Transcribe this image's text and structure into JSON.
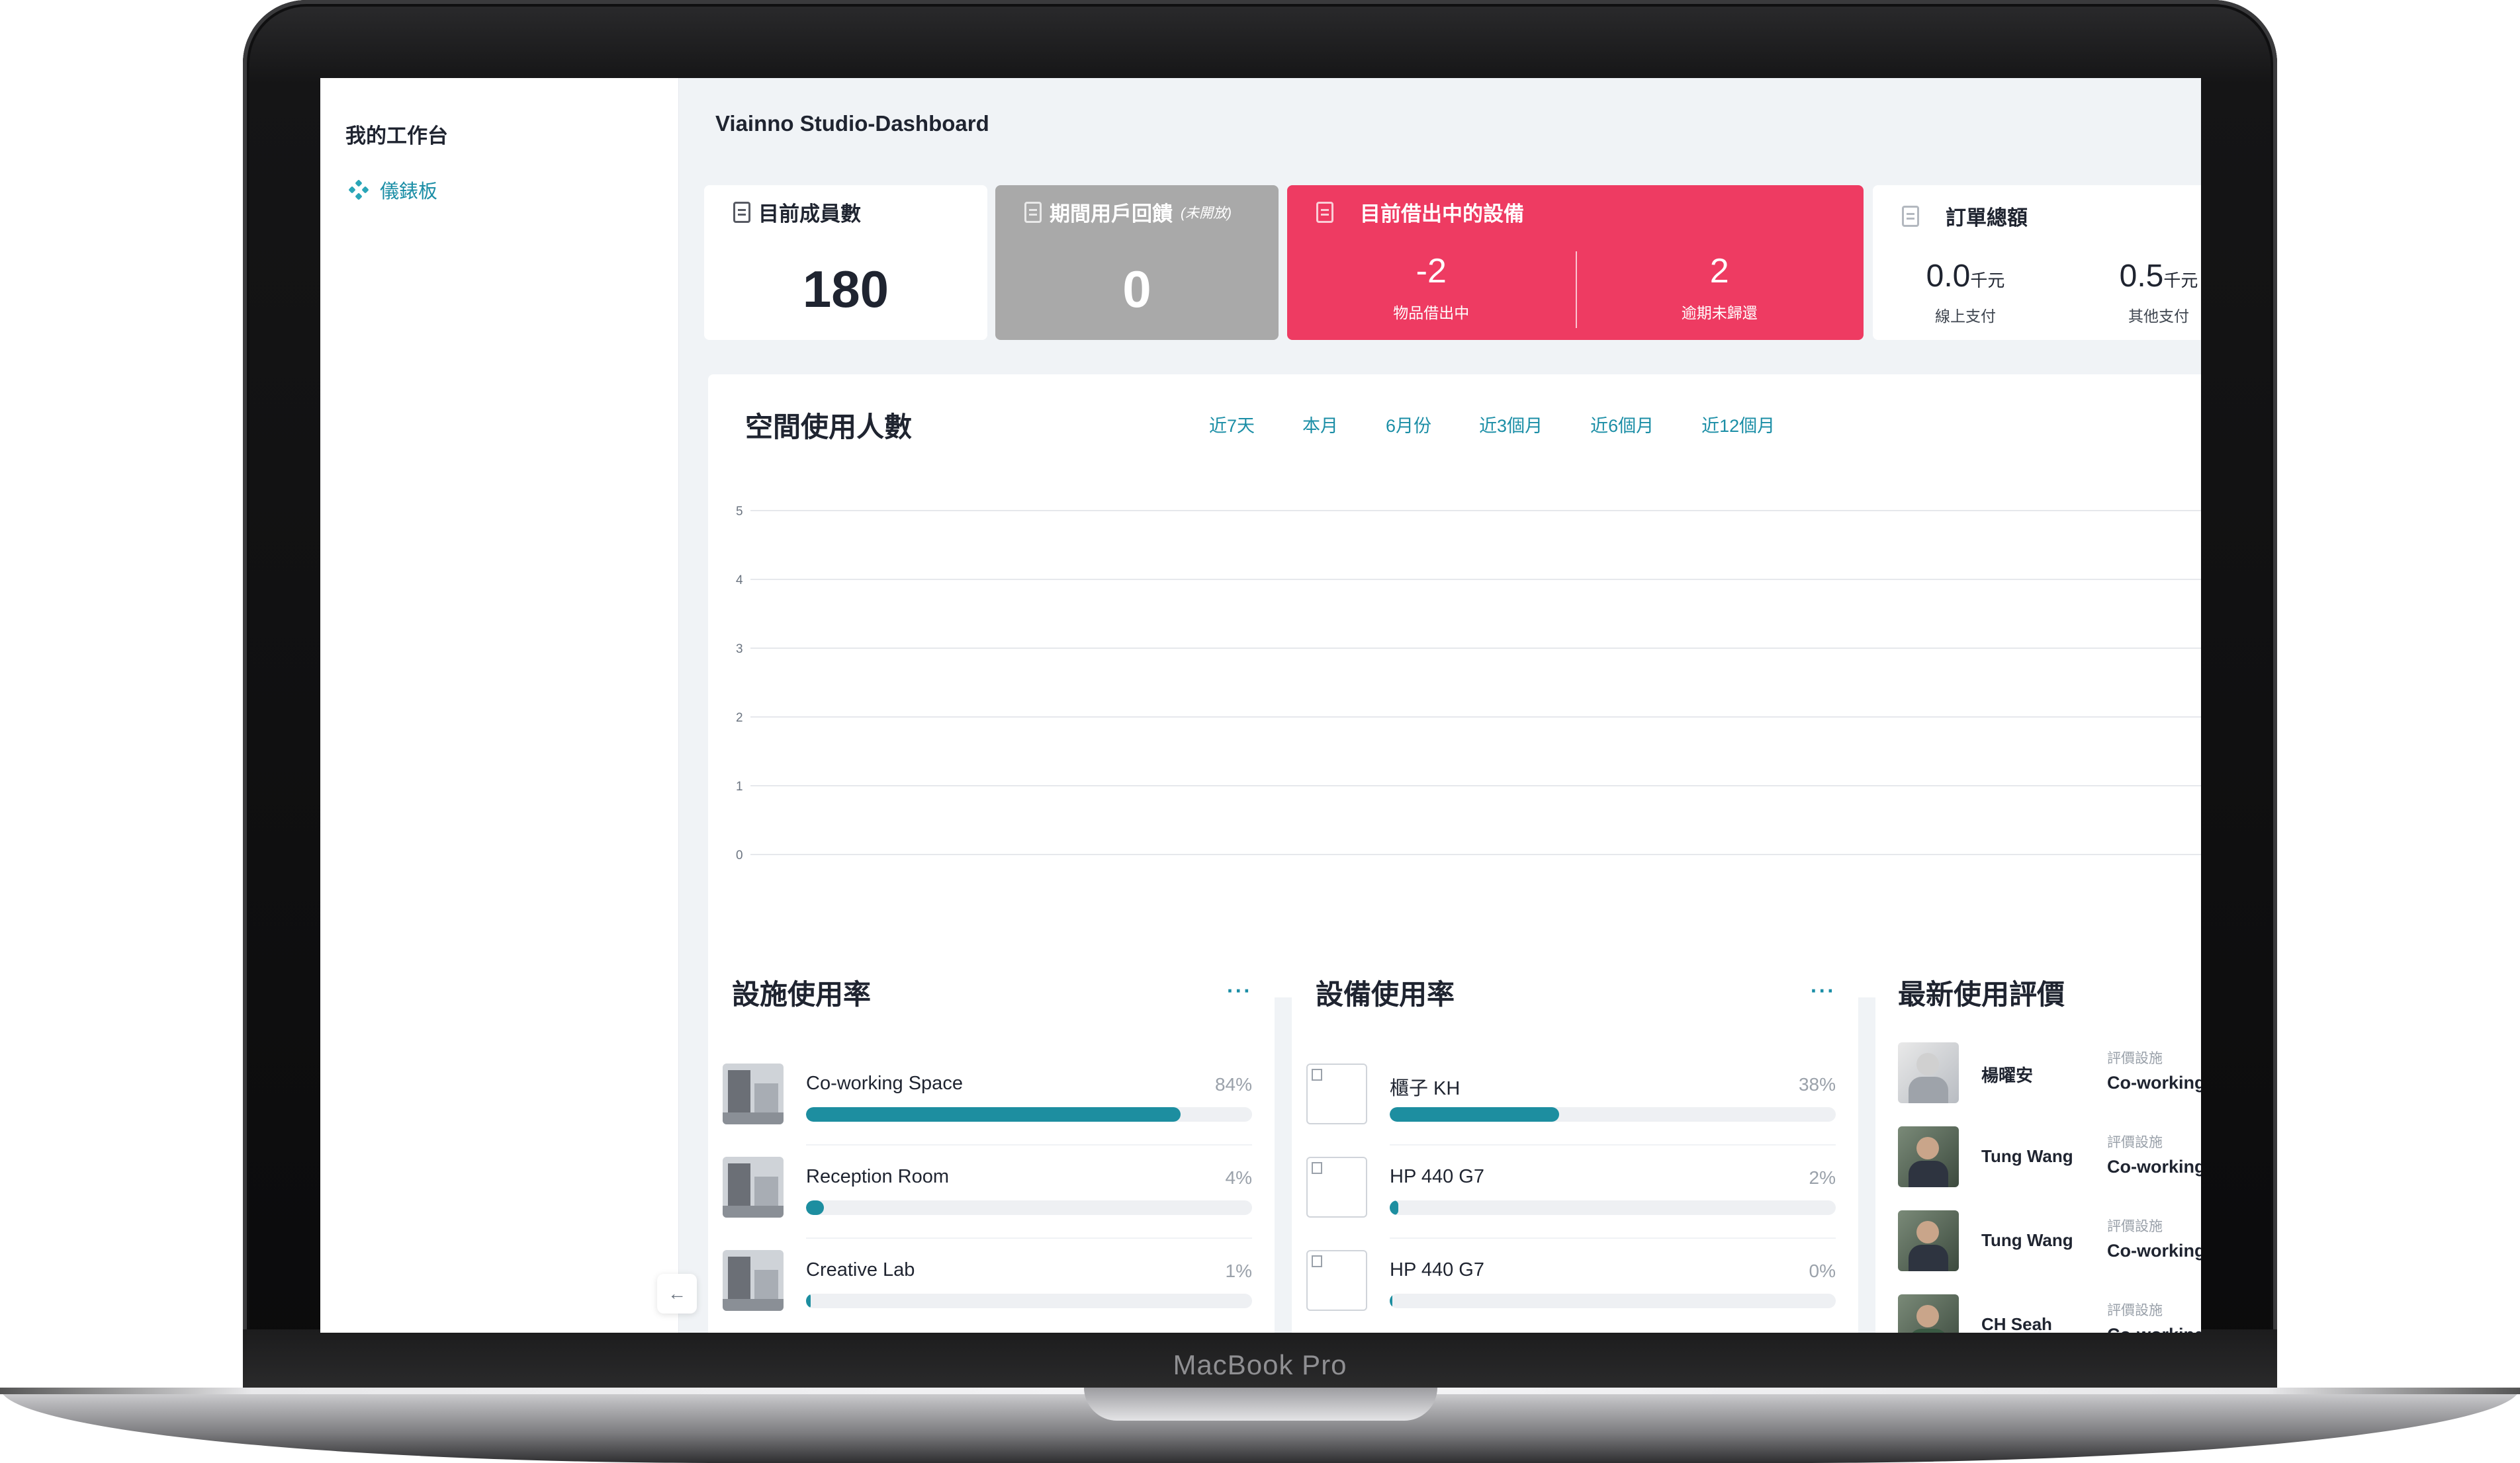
{
  "device_label": "MacBook Pro",
  "sidebar": {
    "workspace_title": "我的工作台",
    "nav_items": [
      {
        "label": "儀錶板",
        "icon": "dashboard-icon",
        "active": true
      }
    ]
  },
  "page_title": "Viainno Studio-Dashboard",
  "stats": {
    "members": {
      "title": "目前成員數",
      "value": "180"
    },
    "feedback": {
      "title": "期間用戶回饋",
      "note": "(未開放)",
      "value": "0"
    },
    "equipment": {
      "title": "目前借出中的設備",
      "on_loan_value": "-2",
      "on_loan_label": "物品借出中",
      "overdue_value": "2",
      "overdue_label": "逾期未歸還"
    },
    "orders": {
      "title": "訂單總額",
      "online_value": "0.0",
      "online_unit": "千元",
      "online_label": "線上支付",
      "other_value": "0.5",
      "other_unit": "千元",
      "other_label": "其他支付"
    }
  },
  "usage_chart": {
    "title": "空間使用人數",
    "ranges": [
      "近7天",
      "本月",
      "6月份",
      "近3個月",
      "近6個月",
      "近12個月"
    ]
  },
  "chart_data": {
    "type": "line",
    "title": "空間使用人數",
    "xlabel": "",
    "ylabel": "",
    "ylim": [
      0,
      5
    ],
    "y_ticks": [
      "0",
      "1",
      "2",
      "3",
      "4",
      "5"
    ],
    "grid": true,
    "series": []
  },
  "facility_usage": {
    "title": "設施使用率",
    "more": "···",
    "items": [
      {
        "name": "Co-working Space",
        "percent_label": "84%",
        "percent": 84
      },
      {
        "name": "Reception Room",
        "percent_label": "4%",
        "percent": 4
      },
      {
        "name": "Creative Lab",
        "percent_label": "1%",
        "percent": 1
      }
    ]
  },
  "equipment_usage": {
    "title": "設備使用率",
    "more": "···",
    "items": [
      {
        "name": "櫃子 KH",
        "percent_label": "38%",
        "percent": 38
      },
      {
        "name": "HP 440 G7",
        "percent_label": "2%",
        "percent": 2
      },
      {
        "name": "HP 440 G7",
        "percent_label": "0%",
        "percent": 0
      }
    ]
  },
  "reviews": {
    "title": "最新使用評價",
    "items": [
      {
        "name": "楊曜安",
        "caption": "評價設施",
        "facility": "Co-working"
      },
      {
        "name": "Tung Wang",
        "caption": "評價設施",
        "facility": "Co-working"
      },
      {
        "name": "Tung Wang",
        "caption": "評價設施",
        "facility": "Co-working"
      },
      {
        "name": "CH Seah",
        "caption": "評價設施",
        "facility": "Co-working"
      }
    ]
  },
  "colors": {
    "accent": "#1b8ea6",
    "bar": "#1d8ea0",
    "alert": "#ee3b62",
    "disabled_card": "#a9a9a9",
    "background": "#f0f3f6"
  }
}
